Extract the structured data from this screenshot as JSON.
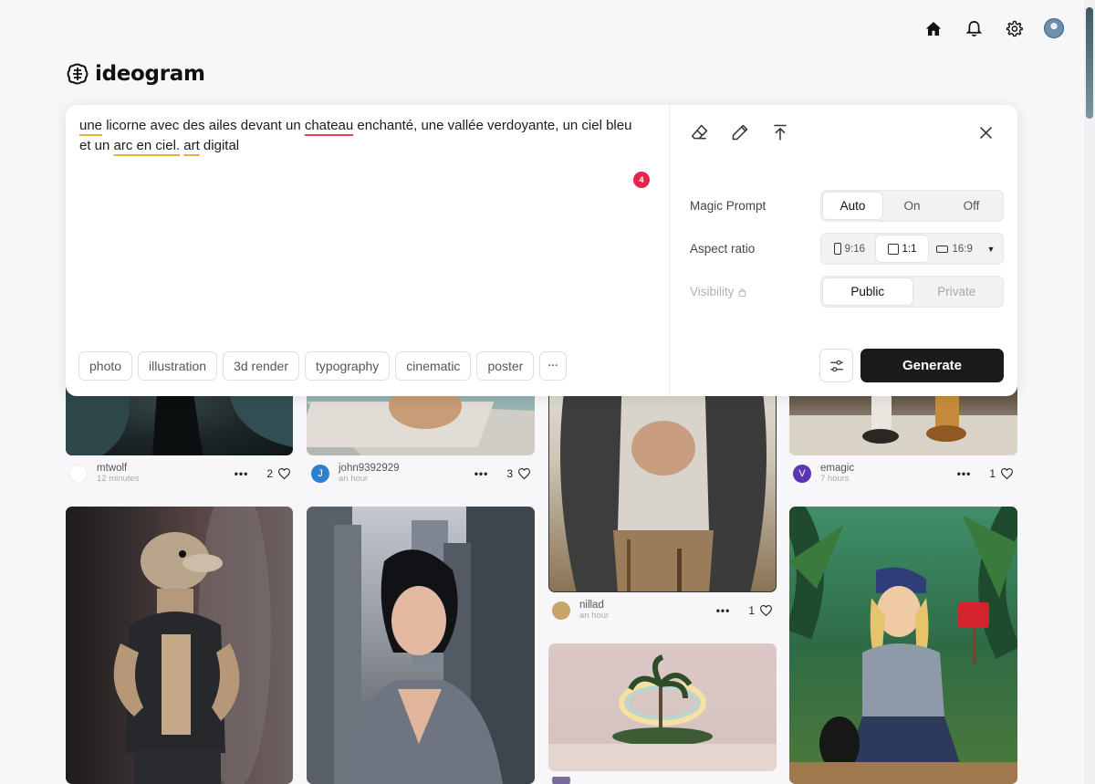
{
  "app": {
    "name": "ideogram"
  },
  "nav": {
    "home_icon": "home-icon",
    "bell_icon": "bell-icon",
    "gear_icon": "gear-icon",
    "avatar": "user-avatar"
  },
  "prompt": {
    "segments": [
      {
        "text": "une",
        "mark": "yellow"
      },
      {
        "text": " licorne avec des ailes devant un ",
        "mark": ""
      },
      {
        "text": "chateau",
        "mark": "red"
      },
      {
        "text": " enchanté, une vallée verdoyante, un ciel bleu et un ",
        "mark": ""
      },
      {
        "text": "arc en ciel.",
        "mark": "yellow"
      },
      {
        "text": " ",
        "mark": ""
      },
      {
        "text": "art",
        "mark": "yellow"
      },
      {
        "text": " digital",
        "mark": ""
      }
    ],
    "issue_count": "4"
  },
  "chips": [
    "photo",
    "illustration",
    "3d render",
    "typography",
    "cinematic",
    "poster",
    "···"
  ],
  "options": {
    "magic_prompt": {
      "label": "Magic Prompt",
      "choices": [
        "Auto",
        "On",
        "Off"
      ],
      "selected": "Auto"
    },
    "aspect_ratio": {
      "label": "Aspect ratio",
      "choices": [
        "9:16",
        "1:1",
        "16:9"
      ],
      "selected": "1:1"
    },
    "visibility": {
      "label": "Visibility",
      "choices": [
        "Public",
        "Private"
      ],
      "selected": "Public"
    }
  },
  "generate_label": "Generate",
  "feed": [
    {
      "user": "mtwolf",
      "time": "12 minutes",
      "likes": "2",
      "avatar_letter": "",
      "avatar_color": "#ffffff"
    },
    {
      "user": "john9392929",
      "time": "an hour",
      "likes": "3",
      "avatar_letter": "J",
      "avatar_color": "#2f7fd1"
    },
    {
      "user": "nillad",
      "time": "an hour",
      "likes": "1",
      "avatar_letter": "",
      "avatar_color": "#c8a46a"
    },
    {
      "user": "emagic",
      "time": "7 hours",
      "likes": "1",
      "avatar_letter": "V",
      "avatar_color": "#5b35b5"
    }
  ],
  "colors": {
    "accent": "#1b1b1d",
    "badge": "#e4264b",
    "underline_yellow": "#e2b13c",
    "underline_red": "#e6455b"
  }
}
